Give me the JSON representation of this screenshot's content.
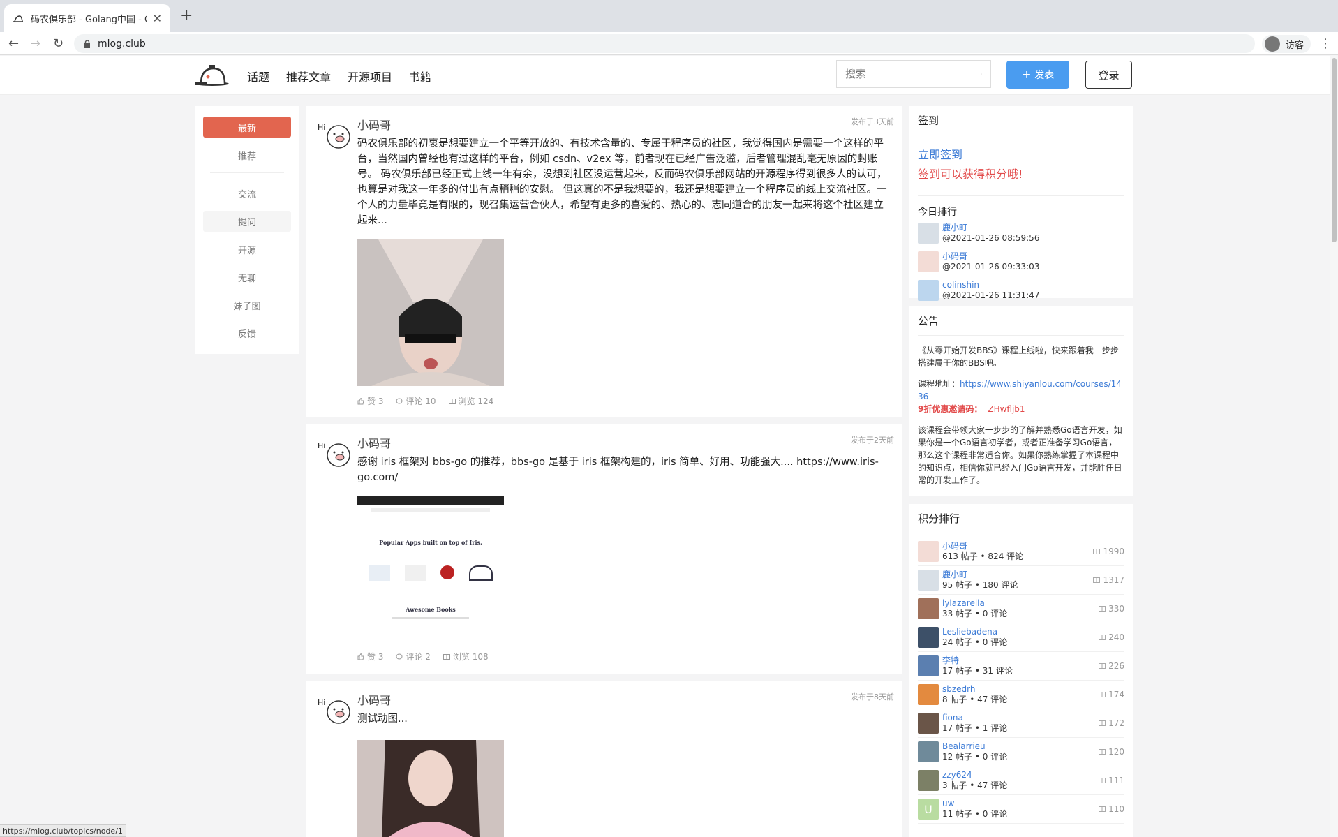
{
  "browser": {
    "tab_title": "码农俱乐部 - Golang中国 - Go语",
    "url": "mlog.club",
    "guest_label": "访客",
    "status_url": "https://mlog.club/topics/node/1"
  },
  "header": {
    "menu": [
      "话题",
      "推荐文章",
      "开源项目",
      "书籍"
    ],
    "search_placeholder": "搜索",
    "publish_label": "＋ 发表",
    "login_label": "登录"
  },
  "leftnav": {
    "items": [
      "最新",
      "推荐",
      "交流",
      "提问",
      "开源",
      "无聊",
      "妹子图",
      "反馈"
    ]
  },
  "posts": [
    {
      "author": "小码哥",
      "time": "发布于3天前",
      "content": "码农俱乐部的初衷是想要建立一个平等开放的、有技术含量的、专属于程序员的社区，我觉得国内是需要一个这样的平台，当然国内曾经也有过这样的平台，例如 csdn、v2ex 等，前者现在已经广告泛滥，后者管理混乱毫无原因的封账号。 码农俱乐部已经正式上线一年有余，没想到社区没运营起来，反而码农俱乐部网站的开源程序得到很多人的认可，也算是对我这一年多的付出有点稍稍的安慰。 但这真的不是我想要的，我还是想要建立一个程序员的线上交流社区。一个人的力量毕竟是有限的，现召集运营合伙人，希望有更多的喜爱的、热心的、志同道合的朋友一起来将这个社区建立起来...",
      "likes": "赞 3",
      "comments": "评论 10",
      "views": "浏览 124"
    },
    {
      "author": "小码哥",
      "time": "发布于2天前",
      "content": "感谢 iris 框架对 bbs-go 的推荐，bbs-go 是基于 iris 框架构建的，iris 简单、好用、功能强大.... https://www.iris-go.com/",
      "img_heading": "Popular Apps built on top of Iris.",
      "img_heading2": "Awesome Books",
      "likes": "赞 3",
      "comments": "评论 2",
      "views": "浏览 108"
    },
    {
      "author": "小码哥",
      "time": "发布于8天前",
      "content": "测试动图..."
    }
  ],
  "checkin": {
    "title": "签到",
    "link": "立即签到",
    "tip": "签到可以获得积分哦!",
    "today_title": "今日排行",
    "today": [
      {
        "name": "鹿小町",
        "time": "@2021-01-26 08:59:56"
      },
      {
        "name": "小码哥",
        "time": "@2021-01-26 09:33:03"
      },
      {
        "name": "colinshin",
        "time": "@2021-01-26 11:31:47"
      }
    ]
  },
  "notice": {
    "title": "公告",
    "p1": "《从零开始开发BBS》课程上线啦，快来跟着我一步步搭建属于你的BBS吧。",
    "url_label": "课程地址：",
    "url": "https://www.shiyanlou.com/courses/1436",
    "code_label": "9折优惠邀请码：",
    "code": "ZHwfljb1",
    "p3": "该课程会带领大家一步步的了解并熟悉Go语言开发，如果你是一个Go语言初学者，或者正准备学习Go语言，那么这个课程非常适合你。如果你熟练掌握了本课程中的知识点，相信你就已经入门Go语言开发，并能胜任日常的开发工作了。"
  },
  "score_rank": {
    "title": "积分排行",
    "rows": [
      {
        "name": "小码哥",
        "sub": "613 帖子 • 824 评论",
        "score": "1990",
        "color": "#f3dcd6"
      },
      {
        "name": "鹿小町",
        "sub": "95 帖子 • 180 评论",
        "score": "1317",
        "color": "#d8dfe6"
      },
      {
        "name": "lylazarella",
        "sub": "33 帖子 • 0 评论",
        "score": "330",
        "color": "#a0705a"
      },
      {
        "name": "Lesliebadena",
        "sub": "24 帖子 • 0 评论",
        "score": "240",
        "color": "#3d5068"
      },
      {
        "name": "李特",
        "sub": "17 帖子 • 31 评论",
        "score": "226",
        "color": "#5b7fb0"
      },
      {
        "name": "sbzedrh",
        "sub": "8 帖子 • 47 评论",
        "score": "174",
        "color": "#e38a3f"
      },
      {
        "name": "fiona",
        "sub": "17 帖子 • 1 评论",
        "score": "172",
        "color": "#6a5548"
      },
      {
        "name": "Bealarrieu",
        "sub": "12 帖子 • 0 评论",
        "score": "120",
        "color": "#6f8a9a"
      },
      {
        "name": "zzy624",
        "sub": "3 帖子 • 47 评论",
        "score": "111",
        "color": "#7c8066"
      },
      {
        "name": "uw",
        "sub": "11 帖子 • 0 评论",
        "score": "110",
        "color": "#b9dca1",
        "letter": "U"
      }
    ]
  },
  "colors": {
    "accent": "#e2654f",
    "link": "#3c7bd6",
    "primary_btn": "#4a9cf0",
    "alert": "#e24a4a"
  }
}
